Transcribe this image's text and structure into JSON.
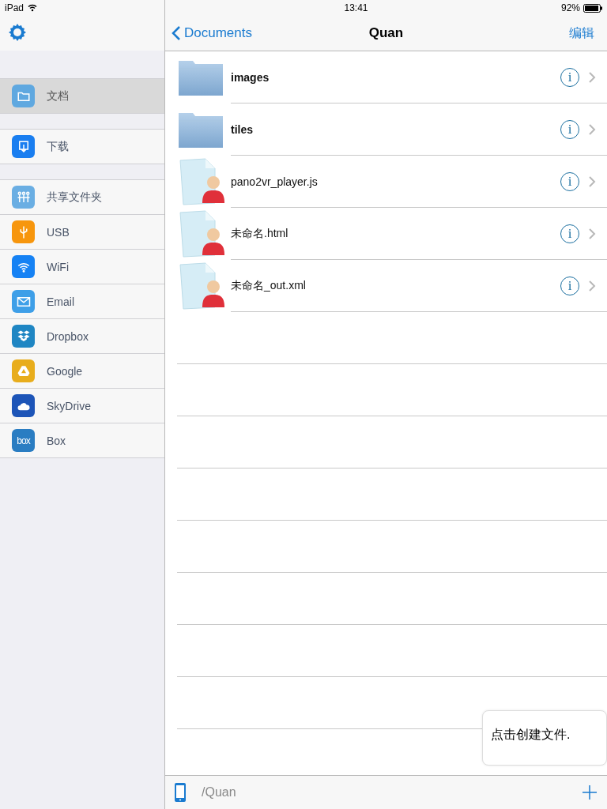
{
  "status_bar": {
    "device": "iPad",
    "time": "13:41",
    "battery": "92%"
  },
  "sidebar": {
    "groups": [
      [
        {
          "label": "文档",
          "kind": "folder",
          "color": "#5fa8e0",
          "selected": true
        }
      ],
      [
        {
          "label": "下载",
          "kind": "download",
          "color": "#1a7ef0",
          "selected": false
        }
      ],
      [
        {
          "label": "共享文件夹",
          "kind": "share",
          "color": "#6aaee3",
          "selected": false
        },
        {
          "label": "USB",
          "kind": "usb",
          "color": "#f7960d",
          "selected": false
        },
        {
          "label": "WiFi",
          "kind": "wifi",
          "color": "#1682f4",
          "selected": false
        },
        {
          "label": "Email",
          "kind": "mail",
          "color": "#3e9fe8",
          "selected": false
        },
        {
          "label": "Dropbox",
          "kind": "dropbox",
          "color": "#1f86c3",
          "selected": false
        },
        {
          "label": "Google",
          "kind": "drive",
          "color": "#e8ad1c",
          "selected": false
        },
        {
          "label": "SkyDrive",
          "kind": "cloud",
          "color": "#1d55b8",
          "selected": false
        },
        {
          "label": "Box",
          "kind": "box",
          "color": "#2a7dc2",
          "logo_text": "box",
          "selected": false
        }
      ]
    ]
  },
  "nav": {
    "back": "Documents",
    "title": "Quan",
    "action": "编辑"
  },
  "files": [
    {
      "name": "images",
      "kind": "folder",
      "info": "i"
    },
    {
      "name": "tiles",
      "kind": "folder",
      "info": "i"
    },
    {
      "name": "pano2vr_player.js",
      "kind": "document",
      "info": "i"
    },
    {
      "name": "未命名.html",
      "kind": "document",
      "info": "i"
    },
    {
      "name": "未命名_out.xml",
      "kind": "document",
      "info": "i"
    }
  ],
  "tooltip": "点击创建文件.",
  "toolbar": {
    "path": "/Quan"
  }
}
